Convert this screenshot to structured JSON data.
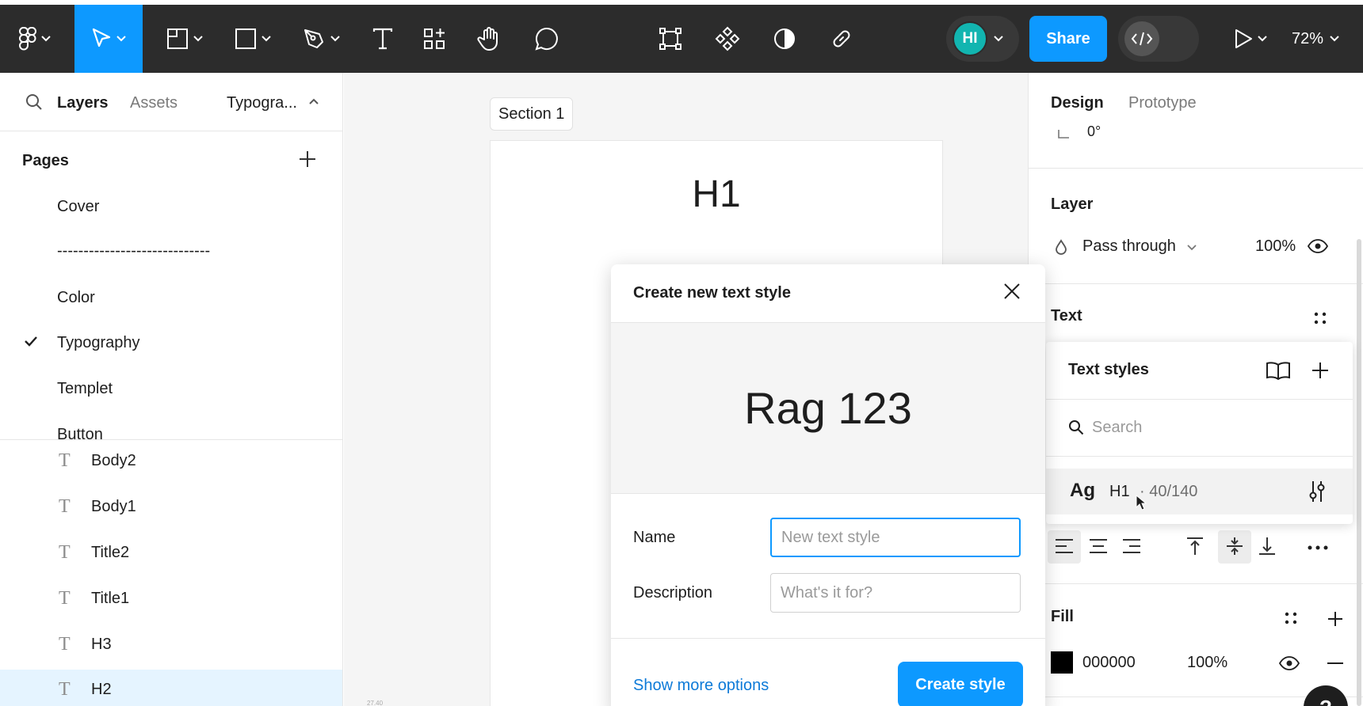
{
  "toolbar": {
    "share_label": "Share",
    "avatar_initials": "HI",
    "zoom_label": "72%",
    "accent_color": "#0d99ff",
    "avatar_color": "#12b5b0",
    "icons": [
      "figma-menu-icon",
      "move-tool-icon",
      "frame-tool-icon",
      "rectangle-tool-icon",
      "pen-tool-icon",
      "text-tool-icon",
      "resources-icon",
      "hand-tool-icon",
      "comment-icon",
      "crop-icon",
      "component-icon",
      "contrast-icon",
      "link-icon",
      "dev-mode-icon",
      "present-icon"
    ]
  },
  "left_panel": {
    "tabs": {
      "layers": "Layers",
      "assets": "Assets",
      "page_dropdown": "Typogra..."
    },
    "pages_title": "Pages",
    "pages": [
      {
        "label": "Cover",
        "current": false
      },
      {
        "label": "-----------------------------",
        "current": false
      },
      {
        "label": "Color",
        "current": false
      },
      {
        "label": "Typography",
        "current": true
      },
      {
        "label": "Templet",
        "current": false
      },
      {
        "label": "Button",
        "current": false
      }
    ],
    "layers": [
      {
        "label": "Body2",
        "selected": false
      },
      {
        "label": "Body1",
        "selected": false
      },
      {
        "label": "Title2",
        "selected": false
      },
      {
        "label": "Title1",
        "selected": false
      },
      {
        "label": "H3",
        "selected": false
      },
      {
        "label": "H2",
        "selected": true
      }
    ]
  },
  "canvas": {
    "section_label": "Section 1",
    "frame_text": "H1",
    "timestamp": "27.40"
  },
  "modal": {
    "title": "Create new text style",
    "preview_text": "Rag 123",
    "name_label": "Name",
    "name_placeholder": "New text style",
    "description_label": "Description",
    "description_placeholder": "What's it for?",
    "more_options": "Show more options",
    "create_button": "Create style"
  },
  "right_panel": {
    "tabs": {
      "design": "Design",
      "prototype": "Prototype"
    },
    "rotation_value": "0°",
    "layer": {
      "title": "Layer",
      "blend_mode": "Pass through",
      "opacity": "100%"
    },
    "text": {
      "title": "Text"
    },
    "fill": {
      "title": "Fill",
      "hex": "000000",
      "opacity": "100%",
      "color": "#000000"
    }
  },
  "text_styles": {
    "title": "Text styles",
    "search_placeholder": "Search",
    "styles": [
      {
        "preview": "Ag",
        "name": "H1",
        "meta": "· 40/140"
      }
    ]
  },
  "help_label": "?"
}
